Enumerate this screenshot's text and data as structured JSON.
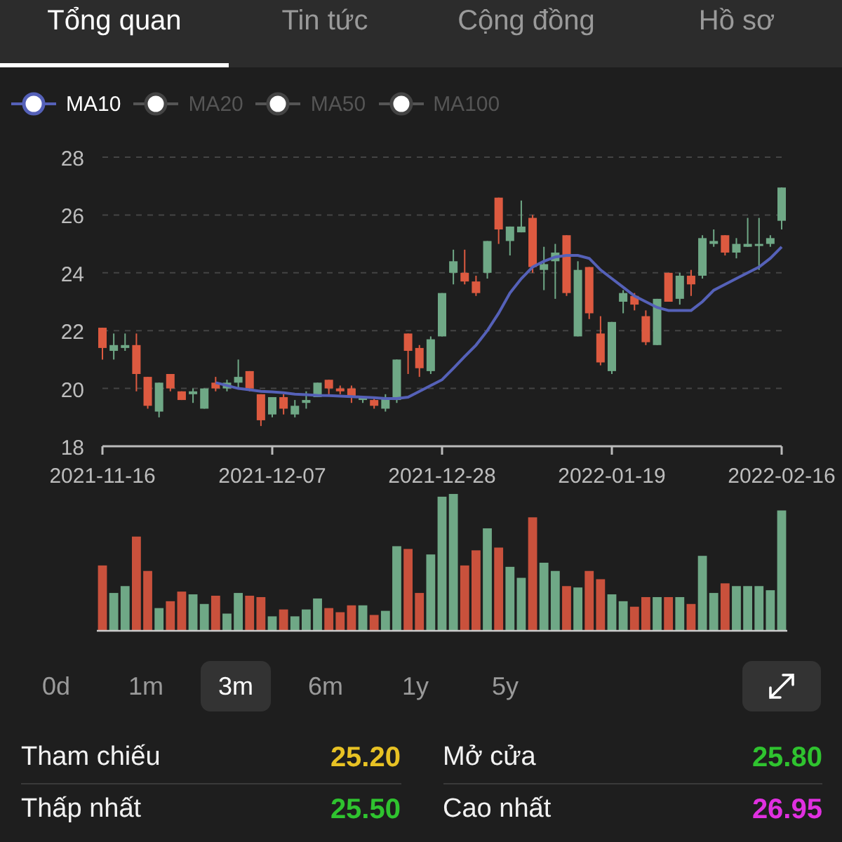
{
  "tabs": [
    {
      "label": "Tổng quan",
      "selected": true
    },
    {
      "label": "Tin tức",
      "selected": false
    },
    {
      "label": "Cộng đồng",
      "selected": false
    },
    {
      "label": "Hồ sơ",
      "selected": false
    }
  ],
  "legend": [
    {
      "selected": true
    },
    {
      "label": "MA20",
      "selected": false
    },
    {
      "label": "MA50",
      "selected": false
    },
    {
      "label": "MA100",
      "selected": false
    }
  ],
  "chart_data": {
    "type": "candlestick",
    "grid": true,
    "ylim": [
      18,
      28
    ],
    "yticks": [
      18,
      20,
      22,
      24,
      26,
      28
    ],
    "categories": [
      "2021-11-16",
      null,
      null,
      null,
      null,
      null,
      null,
      null,
      null,
      null,
      null,
      null,
      null,
      null,
      null,
      "2021-12-07",
      null,
      null,
      null,
      null,
      null,
      null,
      null,
      null,
      null,
      null,
      null,
      null,
      null,
      null,
      "2021-12-28",
      null,
      null,
      null,
      null,
      null,
      null,
      null,
      null,
      null,
      null,
      null,
      null,
      null,
      null,
      "2022-01-19",
      null,
      null,
      null,
      null,
      null,
      null,
      null,
      null,
      null,
      null,
      null,
      null,
      null,
      null,
      "2022-02-16"
    ],
    "ohlc": [
      [
        22.1,
        22.1,
        21.0,
        21.4
      ],
      [
        21.3,
        21.9,
        21.0,
        21.5
      ],
      [
        21.4,
        21.9,
        21.3,
        21.5
      ],
      [
        21.5,
        21.9,
        19.9,
        20.5
      ],
      [
        20.4,
        20.4,
        19.3,
        19.4
      ],
      [
        19.2,
        20.2,
        19.0,
        20.2
      ],
      [
        20.5,
        20.5,
        19.9,
        20.0
      ],
      [
        19.9,
        19.9,
        19.6,
        19.6
      ],
      [
        19.8,
        20.0,
        19.5,
        19.9
      ],
      [
        19.3,
        20.0,
        19.3,
        20.0
      ],
      [
        20.2,
        20.4,
        19.9,
        20.0
      ],
      [
        20.0,
        20.3,
        19.9,
        20.2
      ],
      [
        20.2,
        21.0,
        20.0,
        20.4
      ],
      [
        20.6,
        20.6,
        19.9,
        20.0
      ],
      [
        19.8,
        19.8,
        18.7,
        18.9
      ],
      [
        19.1,
        19.7,
        19.0,
        19.7
      ],
      [
        19.7,
        19.8,
        19.1,
        19.3
      ],
      [
        19.1,
        19.6,
        19.0,
        19.4
      ],
      [
        19.5,
        19.9,
        19.3,
        19.6
      ],
      [
        19.7,
        20.2,
        19.7,
        20.2
      ],
      [
        20.3,
        20.3,
        19.8,
        20.0
      ],
      [
        20.0,
        20.1,
        19.8,
        19.9
      ],
      [
        20.0,
        20.1,
        19.5,
        19.7
      ],
      [
        19.6,
        19.7,
        19.5,
        19.7
      ],
      [
        19.6,
        19.7,
        19.3,
        19.4
      ],
      [
        19.3,
        19.8,
        19.2,
        19.7
      ],
      [
        19.6,
        21.0,
        19.5,
        21.0
      ],
      [
        21.9,
        21.9,
        20.5,
        21.3
      ],
      [
        21.4,
        21.5,
        20.4,
        20.7
      ],
      [
        20.6,
        21.8,
        20.5,
        21.7
      ],
      [
        21.8,
        23.3,
        21.8,
        23.3
      ],
      [
        24.0,
        24.8,
        23.6,
        24.4
      ],
      [
        24.0,
        24.8,
        23.6,
        23.7
      ],
      [
        23.7,
        23.9,
        23.2,
        23.3
      ],
      [
        24.0,
        25.1,
        23.8,
        25.1
      ],
      [
        26.6,
        26.6,
        25.0,
        25.5
      ],
      [
        25.1,
        25.6,
        24.6,
        25.6
      ],
      [
        25.4,
        26.5,
        25.4,
        25.6
      ],
      [
        25.9,
        26.0,
        24.0,
        24.2
      ],
      [
        24.1,
        24.9,
        23.4,
        24.3
      ],
      [
        24.4,
        25.0,
        23.1,
        24.7
      ],
      [
        25.3,
        25.3,
        23.2,
        23.3
      ],
      [
        21.8,
        24.4,
        21.8,
        24.1
      ],
      [
        24.2,
        24.2,
        22.4,
        22.6
      ],
      [
        21.9,
        22.5,
        20.8,
        20.9
      ],
      [
        20.6,
        22.3,
        20.5,
        22.3
      ],
      [
        23.0,
        23.4,
        22.6,
        23.3
      ],
      [
        23.2,
        23.3,
        22.7,
        22.9
      ],
      [
        22.5,
        22.7,
        21.5,
        21.6
      ],
      [
        21.5,
        23.1,
        21.5,
        23.1
      ],
      [
        24.0,
        24.0,
        23.0,
        23.0
      ],
      [
        23.1,
        24.0,
        22.9,
        23.9
      ],
      [
        23.9,
        24.1,
        23.2,
        23.6
      ],
      [
        23.9,
        25.3,
        23.8,
        25.2
      ],
      [
        25.0,
        25.5,
        24.9,
        25.1
      ],
      [
        25.3,
        25.3,
        24.6,
        24.7
      ],
      [
        24.7,
        25.2,
        24.5,
        25.0
      ],
      [
        24.9,
        25.9,
        24.9,
        25.0
      ],
      [
        25.0,
        25.9,
        24.1,
        25.0
      ],
      [
        25.0,
        25.3,
        24.9,
        25.2
      ],
      [
        25.8,
        26.95,
        25.5,
        26.95
      ]
    ],
    "series": [
      {
        "name": "MA10",
        "type": "line",
        "color": "#5561b8",
        "values": [
          null,
          null,
          null,
          null,
          null,
          null,
          null,
          null,
          null,
          null,
          20.2,
          20.1,
          20.0,
          19.95,
          19.9,
          19.88,
          19.85,
          19.8,
          19.78,
          19.76,
          19.75,
          19.74,
          19.72,
          19.7,
          19.68,
          19.65,
          19.65,
          19.7,
          19.9,
          20.1,
          20.3,
          20.7,
          21.1,
          21.5,
          22.0,
          22.6,
          23.3,
          23.8,
          24.2,
          24.4,
          24.55,
          24.6,
          24.6,
          24.5,
          24.1,
          23.8,
          23.5,
          23.2,
          23.0,
          22.8,
          22.7,
          22.7,
          22.7,
          23.0,
          23.4,
          23.6,
          23.8,
          24.0,
          24.2,
          24.5,
          24.9
        ]
      }
    ]
  },
  "ranges": [
    {
      "label": "0d",
      "selected": false
    },
    {
      "label": "1m",
      "selected": false
    },
    {
      "label": "3m",
      "selected": true
    },
    {
      "label": "6m",
      "selected": false
    },
    {
      "label": "1y",
      "selected": false
    },
    {
      "label": "5y",
      "selected": false
    }
  ],
  "stats": [
    {
      "label": "Tham chiếu",
      "value": "25.20",
      "color": "#e8c224"
    },
    {
      "label": "Mở cửa",
      "value": "25.80",
      "color": "#2fc32f"
    },
    {
      "label": "Thấp nhất",
      "value": "25.50",
      "color": "#2fc32f"
    },
    {
      "label": "Cao nhất",
      "value": "26.95",
      "color": "#e030e0"
    }
  ]
}
